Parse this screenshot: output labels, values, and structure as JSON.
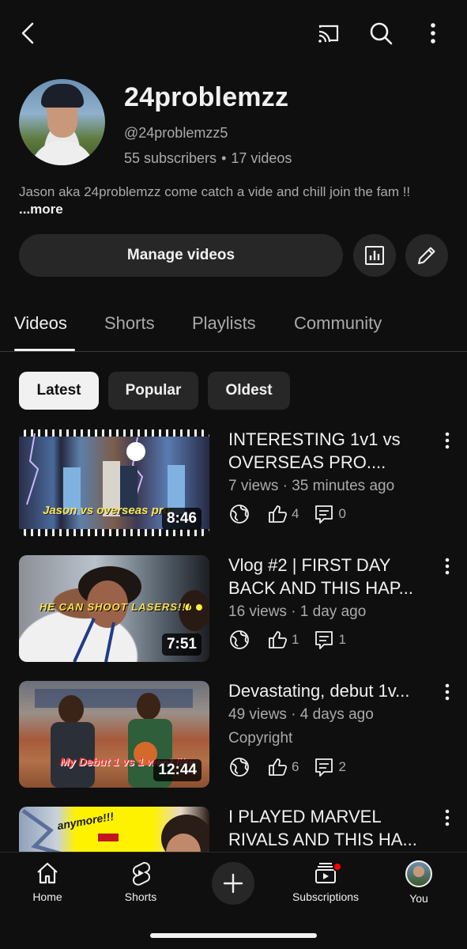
{
  "channel": {
    "name": "24problemzz",
    "handle": "@24problemzz5",
    "subscribers": "55 subscribers",
    "separator": "•",
    "videos_count": "17 videos",
    "description": "Jason aka 24problemzz come catch a vide and chill join the fam !! ",
    "more_label": "...more"
  },
  "actions": {
    "manage_label": "Manage videos"
  },
  "tabs": [
    {
      "label": "Videos",
      "active": true
    },
    {
      "label": "Shorts",
      "active": false
    },
    {
      "label": "Playlists",
      "active": false
    },
    {
      "label": "Community",
      "active": false
    }
  ],
  "chips": [
    {
      "label": "Latest",
      "active": true
    },
    {
      "label": "Popular",
      "active": false
    },
    {
      "label": "Oldest",
      "active": false
    }
  ],
  "videos": [
    {
      "title_line1": "INTERESTING 1v1 vs",
      "title_line2": "OVERSEAS PRO....",
      "meta": "7 views · 35 minutes ago",
      "extra": "",
      "duration": "8:46",
      "overlay": "Jason vs overseas pro",
      "likes": "4",
      "comments": "0"
    },
    {
      "title_line1": "Vlog #2 | FIRST DAY",
      "title_line2": "BACK AND THIS HAP...",
      "meta": "16 views · 1 day ago",
      "extra": "",
      "duration": "7:51",
      "overlay": "HE CAN SHOOT LASERS!!!",
      "likes": "1",
      "comments": "1"
    },
    {
      "title_line1": "Devastating, debut 1v...",
      "title_line2": "",
      "meta": "49 views · 4 days ago",
      "extra": "Copyright",
      "duration": "12:44",
      "overlay": "My Debut 1 vs 1 went like",
      "likes": "6",
      "comments": "2"
    },
    {
      "title_line1": "I PLAYED MARVEL",
      "title_line2": "RIVALS AND THIS HA...",
      "meta": "",
      "extra": "",
      "duration": "",
      "overlay": "anymore!!!",
      "likes": "",
      "comments": ""
    }
  ],
  "nav": {
    "home": "Home",
    "shorts": "Shorts",
    "subscriptions": "Subscriptions",
    "you": "You"
  },
  "colors": {
    "background": "#0f0f0f",
    "surface": "#272727",
    "text_primary": "#f1f1f1",
    "text_secondary": "#aaaaaa",
    "notification": "#ff0000"
  }
}
